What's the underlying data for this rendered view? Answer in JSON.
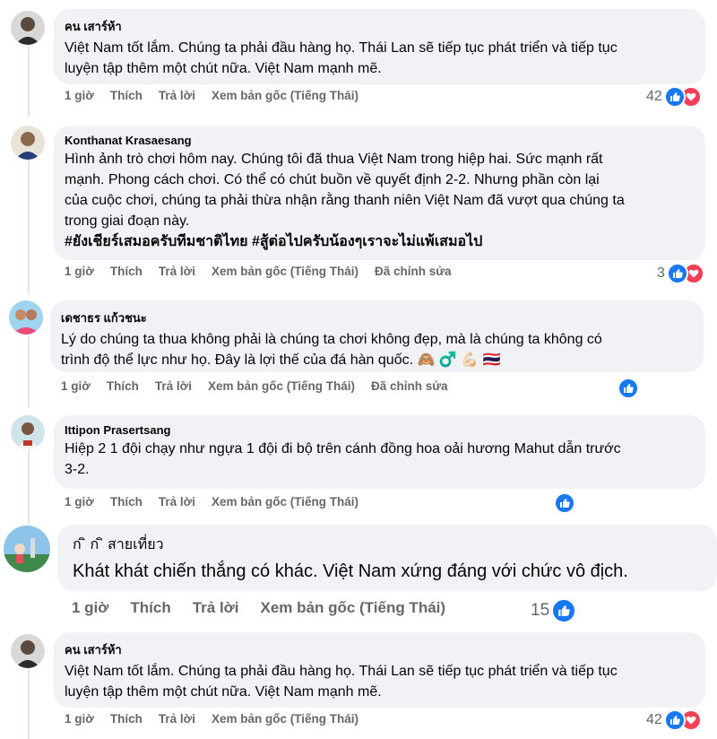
{
  "labels": {
    "like": "Thích",
    "reply": "Trả lời",
    "see_original": "Xem bản gốc (Tiếng Thái)",
    "edited": "Đã chỉnh sửa"
  },
  "comments": [
    {
      "author": "คน เสาร์ห้า",
      "lines": [
        "Việt Nam tốt lắm. Chúng ta phải đầu hàng họ. Thái Lan sẽ tiếp tục phát triển và tiếp tục",
        "luyện tập thêm một chút nữa. Việt Nam mạnh mẽ."
      ],
      "time": "1 giờ",
      "reaction_count": "42"
    },
    {
      "author": "Konthanat Krasaesang",
      "lines": [
        "Hình ảnh trò chơi hôm nay. Chúng tôi đã thua Việt Nam trong hiệp hai. Sức mạnh rất",
        "mạnh. Phong cách chơi. Có thể có chút buồn về quyết định 2-2. Nhưng phần còn lại",
        "của cuộc chơi, chúng ta phải thừa nhận rằng thanh niên Việt Nam đã vượt qua chúng ta",
        "trong giai đoạn này.",
        "#ยังเชียร์เสมอครับทีมชาติไทย #สู้ต่อไปครับน้องๆเราจะไม่แพ้เสมอไป"
      ],
      "time": "1 giờ",
      "reaction_count": "3"
    },
    {
      "author": "เดชาธร แก้วชนะ",
      "lines": [
        "Lý do chúng ta thua không phải là chúng ta chơi không đẹp, mà là chúng ta không có",
        "trình độ thể lực như họ. Đây là lợi thế của đá hàn quốc."
      ],
      "emojis": "🙈 ♂️ 💪🏻 🇹🇭",
      "time": "1 giờ",
      "reaction_count": ""
    },
    {
      "author": "Ittipon Prasertsang",
      "lines": [
        "Hiệp 2 1 đội chạy như ngựa 1 đội đi bộ trên cánh đồng hoa oải hương Mahut dẫn trước",
        "3-2."
      ],
      "time": "1 giờ",
      "reaction_count": ""
    },
    {
      "author": "ก ิ ก ิ สายเที่ยว",
      "lines": [
        "Khát khát chiến thắng có khác. Việt Nam xứng đáng với chức vô địch."
      ],
      "time": "1 giờ",
      "reaction_count": "15"
    },
    {
      "author": "คน เสาร์ห้า",
      "lines": [
        "Việt Nam tốt lắm. Chúng ta phải đầu hàng họ. Thái Lan sẽ tiếp tục phát triển và tiếp tục",
        "luyện tập thêm một chút nữa. Việt Nam mạnh mẽ."
      ],
      "time": "1 giờ",
      "reaction_count": "42"
    }
  ],
  "colors": {
    "bubble": "#f0f2f5",
    "like": "#1877f2",
    "love": "#f33e58",
    "muted": "#65676b"
  }
}
